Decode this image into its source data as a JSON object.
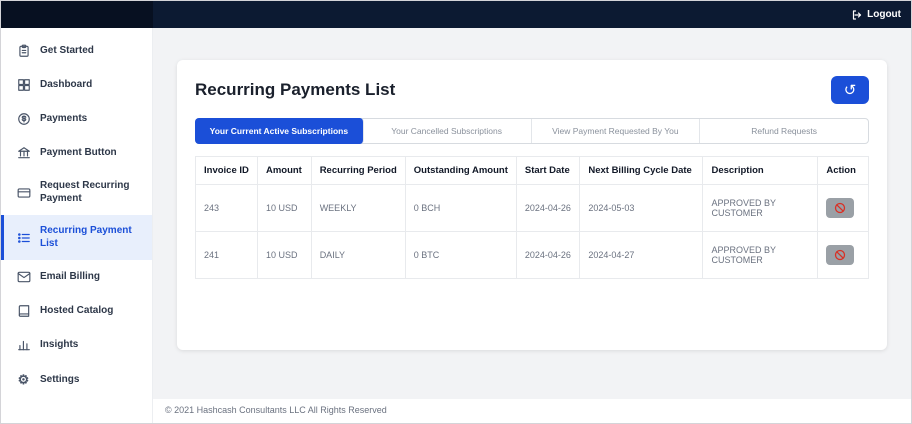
{
  "header": {
    "logout_label": "Logout"
  },
  "icons": {
    "refresh_glyph": "↺",
    "settings_glyph": "⚙"
  },
  "sidebar": {
    "items": [
      {
        "label": "Get Started",
        "icon": "clipboard-icon"
      },
      {
        "label": "Dashboard",
        "icon": "grid-icon"
      },
      {
        "label": "Payments",
        "icon": "dollar-circle-icon"
      },
      {
        "label": "Payment Button",
        "icon": "bank-icon"
      },
      {
        "label": "Request Recurring Payment",
        "icon": "card-icon"
      },
      {
        "label": "Recurring Payment List",
        "icon": "list-icon",
        "active": true
      },
      {
        "label": "Email Billing",
        "icon": "envelope-icon"
      },
      {
        "label": "Hosted Catalog",
        "icon": "book-icon"
      },
      {
        "label": "Insights",
        "icon": "bar-chart-icon"
      },
      {
        "label": "Settings",
        "icon": "gear-icon"
      }
    ]
  },
  "main": {
    "title": "Recurring Payments List",
    "tabs": [
      {
        "label": "Your Current Active Subscriptions",
        "active": true
      },
      {
        "label": "Your Cancelled Subscriptions",
        "active": false
      },
      {
        "label": "View Payment Requested By You",
        "active": false
      },
      {
        "label": "Refund Requests",
        "active": false
      }
    ],
    "table": {
      "headers": [
        "Invoice ID",
        "Amount",
        "Recurring Period",
        "Outstanding Amount",
        "Start Date",
        "Next Billing Cycle Date",
        "Description",
        "Action"
      ],
      "rows": [
        [
          "243",
          "10 USD",
          "WEEKLY",
          "0 BCH",
          "2024-04-26",
          "2024-05-03",
          "APPROVED BY CUSTOMER"
        ],
        [
          "241",
          "10 USD",
          "DAILY",
          "0 BTC",
          "2024-04-26",
          "2024-04-27",
          "APPROVED BY CUSTOMER"
        ]
      ]
    }
  },
  "footer": {
    "copyright": "© 2021 Hashcash Consultants LLC All Rights Reserved"
  },
  "colors": {
    "accent": "#1b4fd8",
    "topbar_bg": "#0c1a32",
    "action_red": "#d93025",
    "action_button_bg": "#9aa0a6",
    "active_item_bg": "#e8effc"
  }
}
